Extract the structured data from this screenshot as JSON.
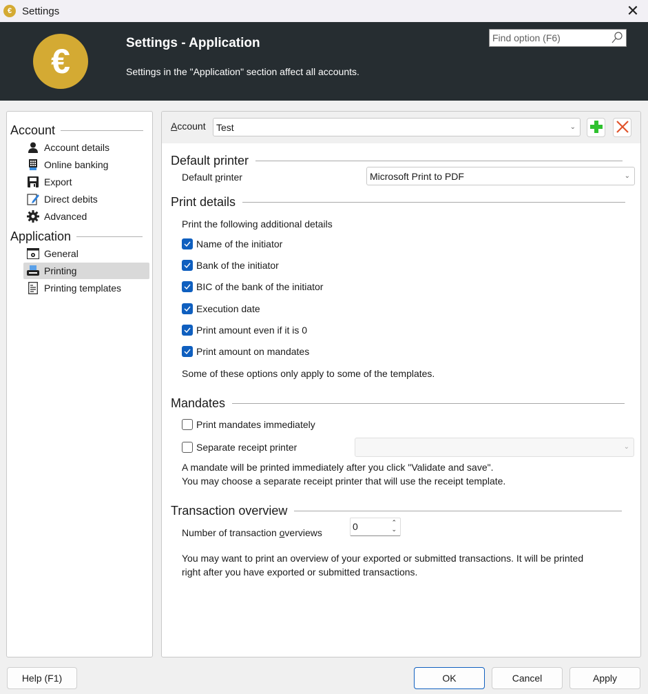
{
  "window": {
    "title": "Settings",
    "app_icon_glyph": "€",
    "close_glyph": "✕"
  },
  "header": {
    "logo_glyph": "€",
    "title": "Settings - Application",
    "subtitle": "Settings in the \"Application\" section affect all accounts.",
    "search_placeholder": "Find option (F6)",
    "search_value": "",
    "brand_color": "#d4aa33",
    "bg_color": "#262d31"
  },
  "sidebar": {
    "groups": [
      {
        "label": "Account",
        "items": [
          {
            "label": "Account details",
            "icon": "user-icon"
          },
          {
            "label": "Online banking",
            "icon": "online-banking-icon"
          },
          {
            "label": "Export",
            "icon": "save-icon"
          },
          {
            "label": "Direct debits",
            "icon": "edit-document-icon"
          },
          {
            "label": "Advanced",
            "icon": "gear-icon"
          }
        ]
      },
      {
        "label": "Application",
        "items": [
          {
            "label": "General",
            "icon": "settings-window-icon"
          },
          {
            "label": "Printing",
            "icon": "printer-icon",
            "active": true
          },
          {
            "label": "Printing templates",
            "icon": "template-icon"
          }
        ]
      }
    ]
  },
  "account_bar": {
    "label_prefix": "A",
    "label_rest": "ccount",
    "selected": "Test",
    "add_icon": "plus-icon",
    "delete_icon": "delete-icon"
  },
  "default_printer": {
    "heading": "Default printer",
    "label_pre": "Default ",
    "label_u": "p",
    "label_post": "rinter",
    "selected": "Microsoft Print to PDF"
  },
  "print_details": {
    "heading": "Print details",
    "intro": "Print the following additional details",
    "options": [
      {
        "label": "Name of the initiator",
        "checked": true
      },
      {
        "label": "Bank of the initiator",
        "checked": true
      },
      {
        "label": "BIC of the bank of the initiator",
        "checked": true
      },
      {
        "label": "Execution date",
        "checked": true
      },
      {
        "label": "Print amount even if it is 0",
        "checked": true
      },
      {
        "label": "Print amount on mandates",
        "checked": true
      }
    ],
    "note": "Some of these options only apply to some of the templates."
  },
  "mandates": {
    "heading": "Mandates",
    "print_immediately": {
      "label": "Print mandates immediately",
      "checked": false
    },
    "separate_printer": {
      "label": "Separate receipt printer",
      "checked": false,
      "selected": ""
    },
    "note_line1": "A mandate will be printed immediately after you click \"Validate and save\".",
    "note_line2": "You may choose a separate receipt printer that will use the receipt template."
  },
  "transaction_overview": {
    "heading": "Transaction overview",
    "label_pre": "Number of transaction ",
    "label_u": "o",
    "label_post": "verviews",
    "value": "0",
    "note_line1": "You may want to print an overview of your exported or submitted transactions. It will be printed",
    "note_line2": "right after you have exported or submitted transactions."
  },
  "footer": {
    "help": "Help (F1)",
    "ok": "OK",
    "cancel": "Cancel",
    "apply": "Apply"
  }
}
